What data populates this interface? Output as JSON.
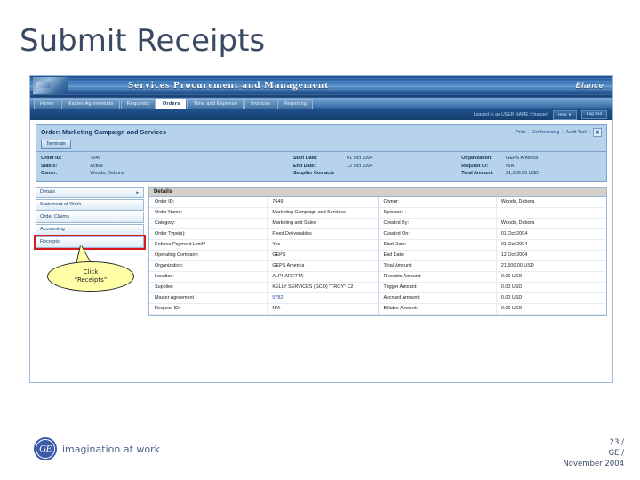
{
  "slide": {
    "title": "Submit Receipts"
  },
  "app": {
    "banner": {
      "title": "Services Procurement and Management",
      "brand": "Elance",
      "logo_icon": "company-logo-icon"
    },
    "tabs": [
      {
        "label": "Home",
        "active": false
      },
      {
        "label": "Master Agreements",
        "active": false
      },
      {
        "label": "Requests",
        "active": false
      },
      {
        "label": "Orders",
        "active": true
      },
      {
        "label": "Time and Expense",
        "active": false
      },
      {
        "label": "Invoices",
        "active": false
      },
      {
        "label": "Reporting",
        "active": false
      }
    ],
    "loginbar": {
      "logged_in_text": "Logged in as USER NAME (change)",
      "help_label": "Help",
      "logout_label": "Log Out"
    },
    "order_strip": {
      "title": "Order: Marketing Campaign and Services",
      "links": [
        "Print",
        "Conferencing",
        "Audit Trail"
      ],
      "icon": "bookmark-icon",
      "button_label": "Terminate"
    },
    "summary": {
      "col1": {
        "labels": [
          "Order ID:",
          "Status:",
          "Owner:"
        ],
        "values": [
          "7649",
          "Active",
          "Woods, Debora"
        ]
      },
      "col2": {
        "labels": [
          "Start Date:",
          "End Date:",
          "Supplier Contacts"
        ],
        "values": [
          "01 Oct 2004",
          "12 Oct 2004",
          ""
        ]
      },
      "col3": {
        "labels": [
          "Organization:",
          "Request ID:",
          "Total Amount:"
        ],
        "values": [
          "GEPS America",
          "N/A",
          "21,500.00 USD"
        ]
      }
    },
    "sidebar": [
      {
        "label": "Details",
        "arrow": "►",
        "selected": false
      },
      {
        "label": "Statement of Work",
        "arrow": "",
        "selected": false
      },
      {
        "label": "Order Claims",
        "arrow": "",
        "selected": false
      },
      {
        "label": "Accounting",
        "arrow": "",
        "selected": false
      },
      {
        "label": "Receipts",
        "arrow": "",
        "selected": true
      }
    ],
    "callout": {
      "line1": "Click",
      "line2": "“Receipts”"
    },
    "details": {
      "heading": "Details",
      "left_rows": [
        {
          "label": "Order ID:",
          "value": "7649"
        },
        {
          "label": "Order Name:",
          "value": "Marketing Campaign and Services"
        },
        {
          "label": "Category:",
          "value": "Marketing and Sales"
        },
        {
          "label": "Order Type(s):",
          "value": "Fixed Deliverables"
        },
        {
          "label": "Enforce Payment Limit?",
          "value": "Yes"
        },
        {
          "label": "Operating Company:",
          "value": "GEPS"
        },
        {
          "label": "Organization:",
          "value": "GEPS America"
        },
        {
          "label": "Location:",
          "value": "ALPHARETTA"
        },
        {
          "label": "Supplier:",
          "value": "KELLY SERVICES (GCO) \"TROY\" C2"
        },
        {
          "label": "Master Agreement",
          "value": "5782",
          "is_link": true
        },
        {
          "label": "Request ID:",
          "value": "N/A"
        }
      ],
      "right_rows": [
        {
          "label": "Owner:",
          "value": "Woods, Debora"
        },
        {
          "label": "Sponsor:",
          "value": ""
        },
        {
          "label": "Created By:",
          "value": "Woods, Debora"
        },
        {
          "label": "Created On:",
          "value": "01 Oct 2004"
        },
        {
          "label": "Start Date:",
          "value": "01 Oct 2004"
        },
        {
          "label": "End Date:",
          "value": "12 Oct 2004"
        },
        {
          "label": "Total Amount:",
          "value": "21,500.00 USD"
        },
        {
          "label": "Receipts Amount:",
          "value": "0.00 USD"
        },
        {
          "label": "Trigger Amount:",
          "value": "0.00 USD"
        },
        {
          "label": "Accrued Amount:",
          "value": "0.00 USD"
        },
        {
          "label": "Billable Amount:",
          "value": "0.00 USD"
        }
      ]
    }
  },
  "footer": {
    "logo_letters": "GE",
    "tagline": "imagination at work",
    "line1": "23 /",
    "line2": "GE /",
    "line3": "November 2004"
  },
  "colors": {
    "title": "#3b4a63",
    "banner_blue": "#2f6bae",
    "highlight_red": "#d81920",
    "callout_yellow": "#ffffa8"
  }
}
